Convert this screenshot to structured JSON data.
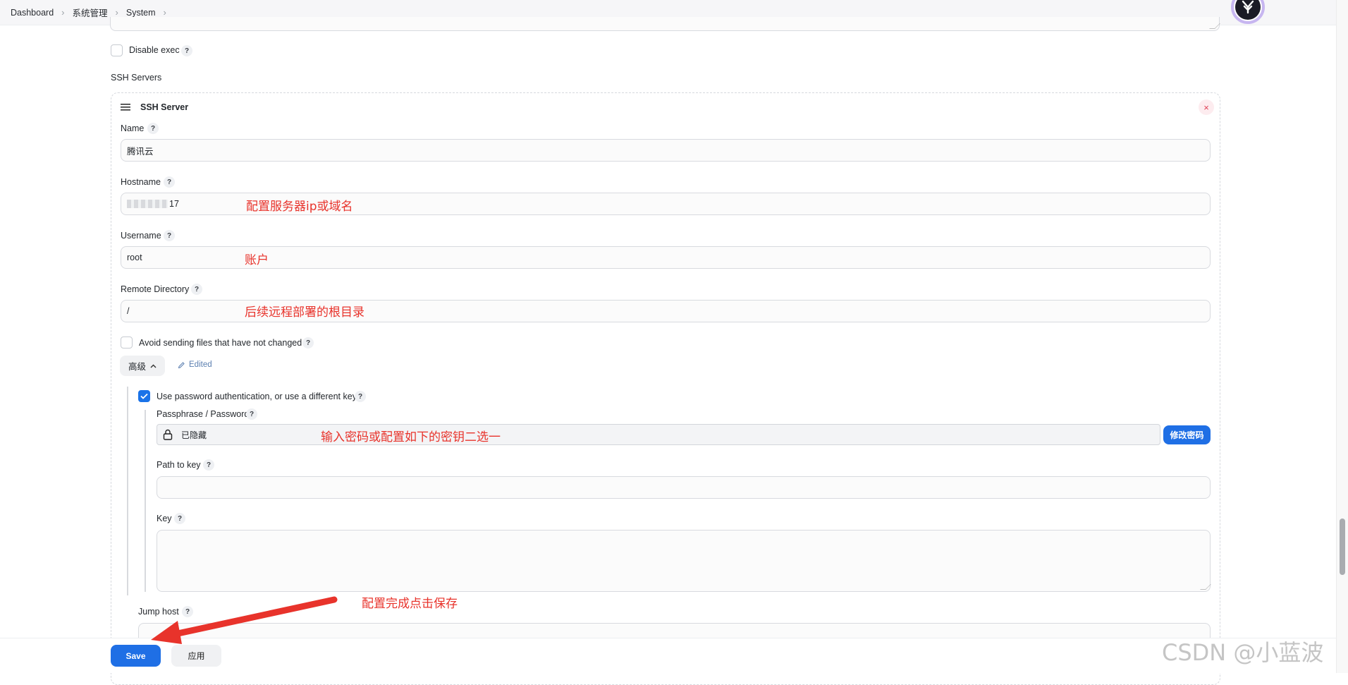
{
  "breadcrumb": [
    "Dashboard",
    "系统管理",
    "System"
  ],
  "disable_exec": {
    "label": "Disable exec",
    "help": "?"
  },
  "ssh_servers_label": "SSH Servers",
  "ssh_server": {
    "title": "SSH Server",
    "close_icon": "×",
    "name": {
      "label": "Name",
      "value": "腾讯云"
    },
    "hostname": {
      "label": "Hostname",
      "value_suffix": "17"
    },
    "username": {
      "label": "Username",
      "value": "root"
    },
    "remote_directory": {
      "label": "Remote Directory",
      "value": "/"
    },
    "avoid_sending": {
      "label": "Avoid sending files that have not changed"
    },
    "advanced_button": "高级",
    "edited_label": "Edited",
    "use_password": {
      "label": "Use password authentication, or use a different key",
      "checked": true
    },
    "passphrase": {
      "label": "Passphrase / Password",
      "value": "已隐藏",
      "change_button": "修改密码"
    },
    "path_to_key": {
      "label": "Path to key",
      "value": ""
    },
    "key": {
      "label": "Key",
      "value": ""
    },
    "jump_host": {
      "label": "Jump host"
    }
  },
  "annotations": {
    "hostname": "配置服务器ip或域名",
    "username": "账户",
    "remote_directory": "后续远程部署的根目录",
    "password": "输入密码或配置如下的密钥二选一",
    "save": "配置完成点击保存"
  },
  "footer": {
    "save": "Save",
    "apply": "应用"
  },
  "watermark": "CSDN @小蓝波",
  "colors": {
    "accent": "#1f6fe5",
    "annotation": "#e8332b"
  },
  "icons": {
    "menu": "hamburger-icon",
    "lock": "lock-icon",
    "pencil": "pencil-icon",
    "chevron_up": "chevron-up-icon",
    "check": "check-icon"
  }
}
